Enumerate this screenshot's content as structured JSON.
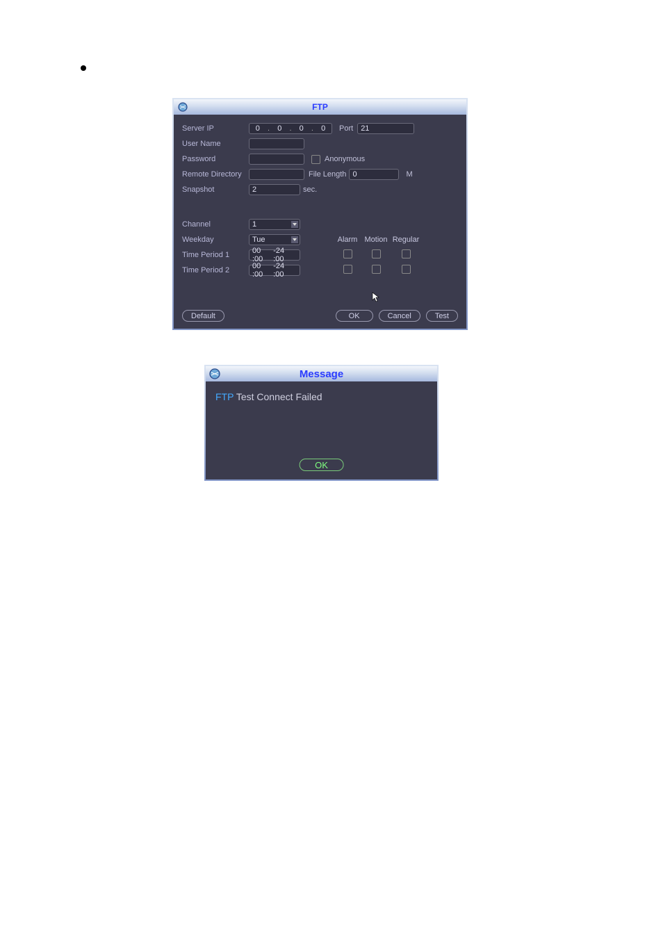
{
  "ftp": {
    "title": "FTP",
    "labels": {
      "server_ip": "Server IP",
      "user_name": "User Name",
      "password": "Password",
      "remote_dir": "Remote Directory",
      "snapshot": "Snapshot",
      "channel": "Channel",
      "weekday": "Weekday",
      "tp1": "Time Period 1",
      "tp2": "Time Period 2",
      "port": "Port",
      "anonymous": "Anonymous",
      "file_length": "File Length",
      "file_length_unit": "M",
      "sec": "sec."
    },
    "values": {
      "ip": [
        "0",
        "0",
        "0",
        "0"
      ],
      "port": "21",
      "user_name": "",
      "password": "",
      "remote_dir": "",
      "file_length": "0",
      "snapshot": "2",
      "channel": "1",
      "weekday": "Tue",
      "tp1_start": "00 :00",
      "tp1_end": "-24 :00",
      "tp2_start": "00 :00",
      "tp2_end": "-24 :00"
    },
    "headers": {
      "alarm": "Alarm",
      "motion": "Motion",
      "regular": "Regular"
    },
    "buttons": {
      "default": "Default",
      "ok": "OK",
      "cancel": "Cancel",
      "test": "Test"
    }
  },
  "message": {
    "title": "Message",
    "text_prefix": "FTP",
    "text_rest": " Test Connect Failed",
    "ok": "OK"
  }
}
